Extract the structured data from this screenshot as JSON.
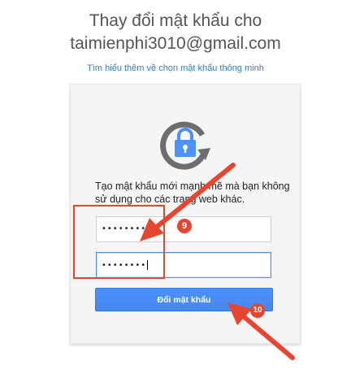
{
  "header": {
    "title_line1": "Thay đổi mật khẩu cho",
    "title_line2": "taimienphi3010@gmail.com",
    "learn_more_link": "Tìm hiểu thêm về chọn mật khẩu thông minh"
  },
  "card": {
    "icon": "lock-refresh-icon",
    "description": "Tạo mật khẩu mới mạnh mẽ mà bạn không sử dụng cho các trang web khác.",
    "new_password_value": "••••••••",
    "confirm_password_value": "••••••••",
    "submit_label": "Đổi mật khẩu"
  },
  "annotations": {
    "badge_9": "9",
    "badge_10": "10",
    "color": "#e8452f"
  },
  "colors": {
    "accent": "#4d90fe",
    "link": "#2f7bd6"
  }
}
